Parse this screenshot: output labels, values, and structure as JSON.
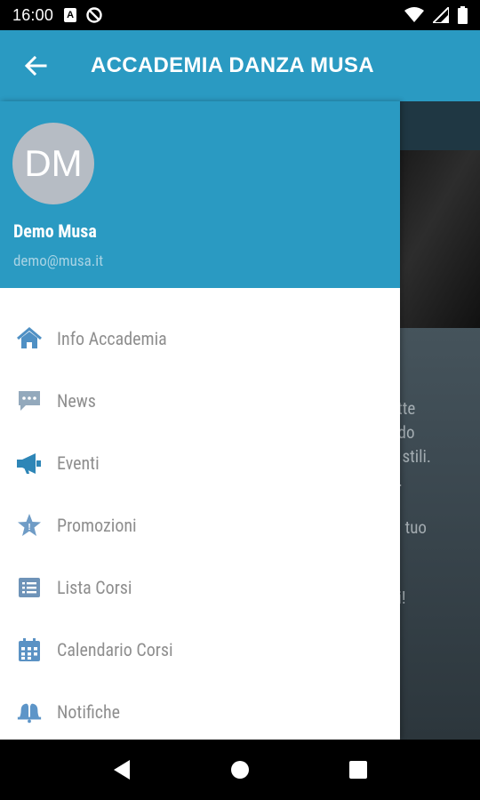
{
  "status_bar": {
    "time": "16:00",
    "notification_icons": [
      "a-box-icon",
      "no-sync-icon"
    ],
    "system_icons": [
      "wifi-icon",
      "signal-icon",
      "battery-icon"
    ]
  },
  "app_bar": {
    "title": "ACCADEMIA DANZA MUSA",
    "back_icon": "arrow-left-icon",
    "color": "#2a9ac2"
  },
  "drawer": {
    "header_color": "#2a9ac2",
    "avatar_initials": "DM",
    "user_name": "Demo Musa",
    "user_email": "demo@musa.it",
    "items": [
      {
        "label": "Info Accademia",
        "icon": "home-icon"
      },
      {
        "label": "News",
        "icon": "chat-bubble-icon"
      },
      {
        "label": "Eventi",
        "icon": "megaphone-icon"
      },
      {
        "label": "Promozioni",
        "icon": "star-badge-icon"
      },
      {
        "label": "Lista Corsi",
        "icon": "list-icon"
      },
      {
        "label": "Calendario Corsi",
        "icon": "calendar-icon"
      },
      {
        "label": "Notifiche",
        "icon": "bells-icon"
      }
    ]
  },
  "background_text": [
    "utte",
    "odo",
    "ri stili.",
    "S.",
    "el tuo",
    "oi!"
  ],
  "nav_bar": {
    "buttons": [
      "back-triangle-icon",
      "home-circle-icon",
      "recents-square-icon"
    ]
  }
}
